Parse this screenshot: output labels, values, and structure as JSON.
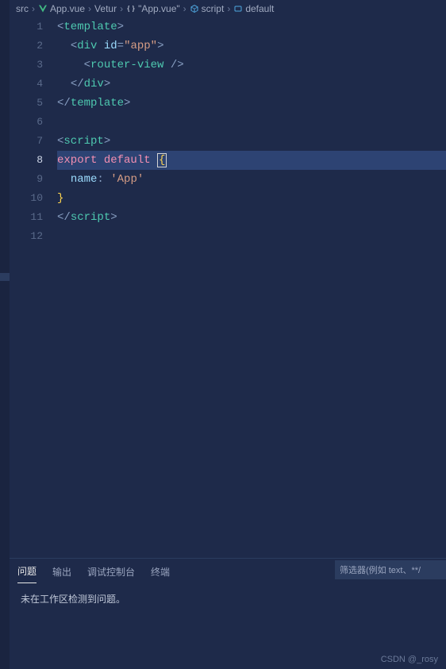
{
  "breadcrumb": {
    "items": [
      {
        "label": "src",
        "icon": null
      },
      {
        "label": "App.vue",
        "icon": "vue"
      },
      {
        "label": "Vetur",
        "icon": null
      },
      {
        "label": "\"App.vue\"",
        "icon": "braces"
      },
      {
        "label": "script",
        "icon": "module"
      },
      {
        "label": "default",
        "icon": "symbol"
      }
    ],
    "sep": "›"
  },
  "editor": {
    "active_line": 8,
    "lines": [
      {
        "n": 1,
        "tokens": [
          [
            "punc",
            "<"
          ],
          [
            "tag",
            "template"
          ],
          [
            "punc",
            ">"
          ]
        ]
      },
      {
        "n": 2,
        "indent": 2,
        "tokens": [
          [
            "punc",
            "<"
          ],
          [
            "tag",
            "div"
          ],
          [
            "name",
            " "
          ],
          [
            "attr",
            "id"
          ],
          [
            "punc",
            "="
          ],
          [
            "str",
            "\"app\""
          ],
          [
            "punc",
            ">"
          ]
        ]
      },
      {
        "n": 3,
        "indent": 4,
        "tokens": [
          [
            "punc",
            "<"
          ],
          [
            "tag",
            "router-view"
          ],
          [
            "name",
            " "
          ],
          [
            "punc",
            "/>"
          ]
        ]
      },
      {
        "n": 4,
        "indent": 2,
        "tokens": [
          [
            "punc",
            "</"
          ],
          [
            "tag",
            "div"
          ],
          [
            "punc",
            ">"
          ]
        ]
      },
      {
        "n": 5,
        "tokens": [
          [
            "punc",
            "</"
          ],
          [
            "tag",
            "template"
          ],
          [
            "punc",
            ">"
          ]
        ]
      },
      {
        "n": 6,
        "tokens": []
      },
      {
        "n": 7,
        "tokens": [
          [
            "punc",
            "<"
          ],
          [
            "tag",
            "script"
          ],
          [
            "punc",
            ">"
          ]
        ]
      },
      {
        "n": 8,
        "tokens": [
          [
            "kw",
            "export"
          ],
          [
            "name",
            " "
          ],
          [
            "kw",
            "default"
          ],
          [
            "name",
            " "
          ],
          [
            "cursor",
            "{"
          ]
        ]
      },
      {
        "n": 9,
        "indent": 2,
        "tokens": [
          [
            "attr",
            "name"
          ],
          [
            "punc",
            ":"
          ],
          [
            "name",
            " "
          ],
          [
            "str",
            "'App'"
          ]
        ]
      },
      {
        "n": 10,
        "tokens": [
          [
            "brace",
            "}"
          ]
        ]
      },
      {
        "n": 11,
        "tokens": [
          [
            "punc",
            "</"
          ],
          [
            "tag",
            "script"
          ],
          [
            "punc",
            ">"
          ]
        ]
      },
      {
        "n": 12,
        "tokens": []
      }
    ]
  },
  "panel": {
    "tabs": [
      {
        "label": "问题",
        "active": true
      },
      {
        "label": "输出",
        "active": false
      },
      {
        "label": "调试控制台",
        "active": false
      },
      {
        "label": "终端",
        "active": false
      }
    ],
    "filter_placeholder": "筛选器(例如 text、**/",
    "message": "未在工作区检测到问题。"
  },
  "watermark": "CSDN @_rosy"
}
